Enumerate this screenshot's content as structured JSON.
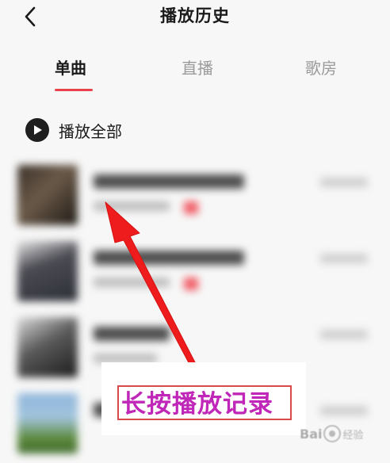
{
  "header": {
    "title": "播放历史",
    "back_icon": "chevron-left-icon"
  },
  "tabs": [
    {
      "label": "单曲",
      "active": true
    },
    {
      "label": "直播",
      "active": false
    },
    {
      "label": "歌房",
      "active": false
    }
  ],
  "play_all": {
    "label": "播放全部",
    "icon": "play-circle-icon"
  },
  "annotation": {
    "text": "长按播放记录"
  },
  "watermark": {
    "text": "Bai",
    "suffix": "经验"
  },
  "colors": {
    "accent": "#e8424d",
    "annotation_text": "#c026b8",
    "annotation_border": "#d64a4a",
    "arrow": "#ee1c1c"
  }
}
